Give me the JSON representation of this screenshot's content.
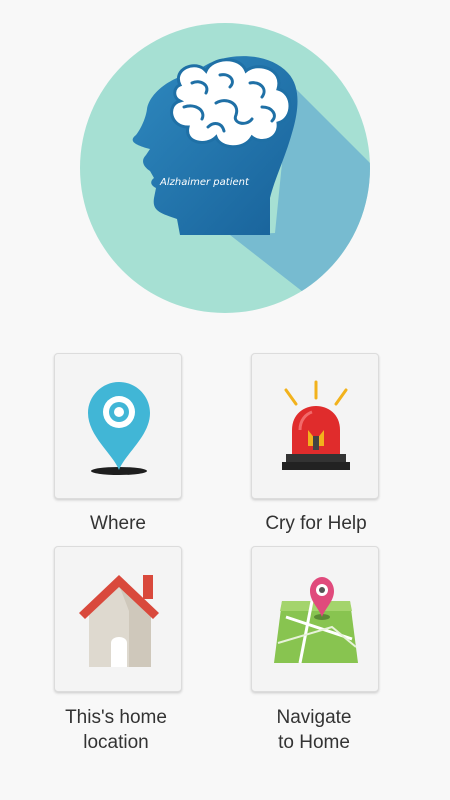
{
  "hero": {
    "caption": "Alzhaimer patient",
    "icon": "head-brain-icon"
  },
  "menu": [
    {
      "label": "Where",
      "icon": "map-pin-icon"
    },
    {
      "label": "Cry for Help",
      "icon": "siren-icon"
    },
    {
      "label": "This's home\nlocation",
      "icon": "house-icon"
    },
    {
      "label": "Navigate\nto Home",
      "icon": "map-navigate-icon"
    }
  ],
  "colors": {
    "background": "#f8f8f8",
    "hero_circle": "#a6e0d3",
    "head": "#1f70a6",
    "pin": "#3fb4d4",
    "siren": "#e02c2c",
    "roof": "#d9493c",
    "map": "#88c450"
  }
}
